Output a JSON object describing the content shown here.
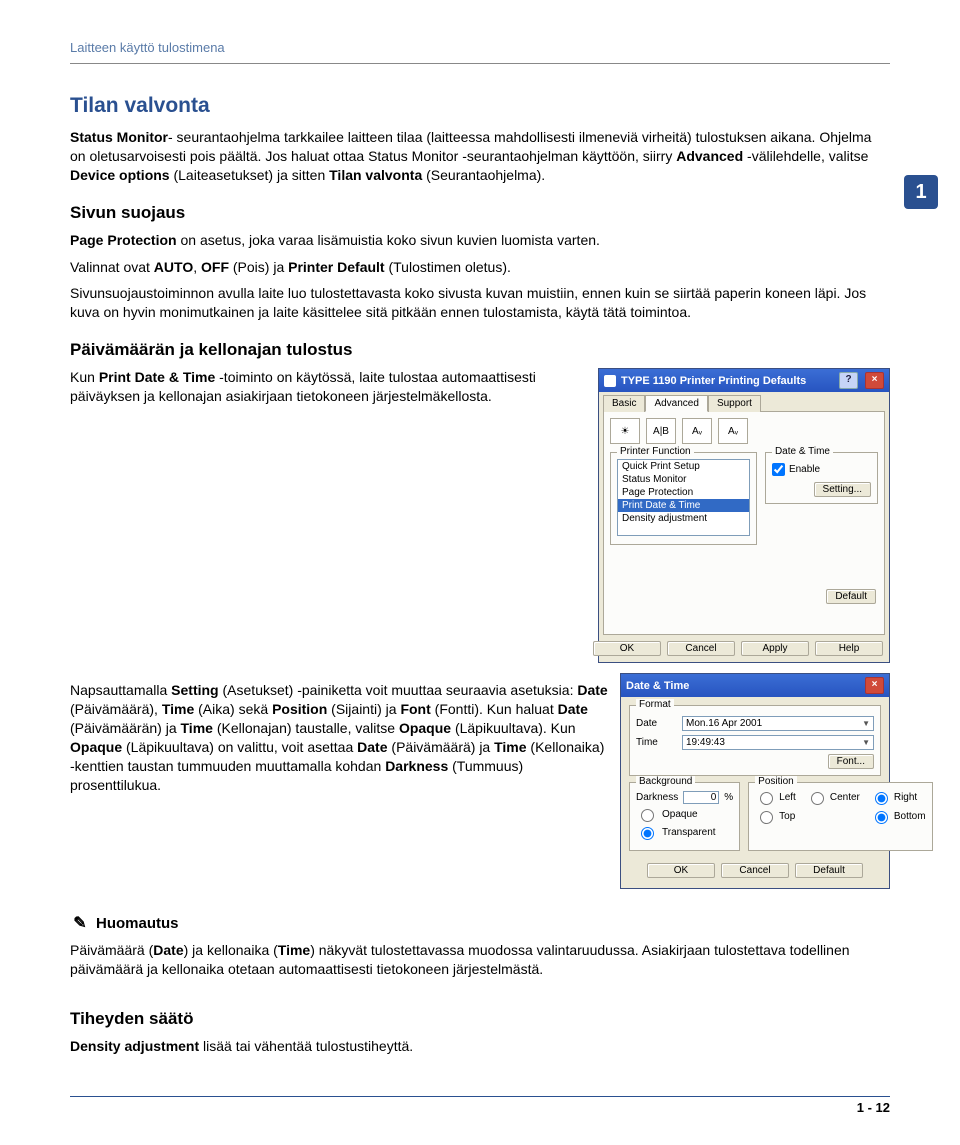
{
  "header": "Laitteen käyttö tulostimena",
  "sectionBadge": "1",
  "tilan": {
    "title": "Tilan valvonta",
    "p1_a": "Status Monitor",
    "p1_b": "- seurantaohjelma tarkkailee laitteen tilaa (laitteessa mahdollisesti ilmeneviä virheitä) tulostuksen aikana. Ohjelma on oletusarvoisesti pois päältä. Jos haluat ottaa Status Monitor -seurantaohjelman käyttöön, siirry ",
    "p1_c": "Advanced",
    "p1_d": " ",
    "p1_e": "-välilehdelle, valitse ",
    "p1_f": "Device options",
    "p1_g": " (Laiteasetukset) ja sitten ",
    "p1_h": "Tilan valvonta",
    "p1_i": " (Seurantaohjelma)."
  },
  "sivun": {
    "title": "Sivun suojaus",
    "p1_a": "Page Protection",
    "p1_b": " on asetus, joka varaa lisämuistia koko sivun kuvien luomista varten.",
    "p2_a": "Valinnat ovat ",
    "p2_b": "AUTO",
    "p2_c": ", ",
    "p2_d": "OFF",
    "p2_e": " (Pois) ja ",
    "p2_f": "Printer Default",
    "p2_g": " (Tulostimen oletus).",
    "p3": "Sivunsuojaustoiminnon avulla laite luo tulostettavasta koko sivusta kuvan muistiin, ennen kuin se siirtää paperin koneen läpi. Jos kuva on hyvin monimutkainen ja laite käsittelee sitä pitkään ennen tulostamista, käytä tätä toimintoa."
  },
  "paiva": {
    "title": "Päivämäärän ja kellonajan tulostus",
    "p1_a": "Kun ",
    "p1_b": "Print Date & Time",
    "p1_c": " -toiminto on käytössä, laite tulostaa automaattisesti päiväyksen ja kellonajan asiakirjaan tietokoneen järjestelmäkellosta.",
    "p2_a": "Napsauttamalla ",
    "p2_b": "Setting",
    "p2_c": " (Asetukset) -painiketta voit muuttaa seuraavia asetuksia: ",
    "p2_d": "Date",
    "p2_e": " (Päivämäärä), ",
    "p2_f": "Time",
    "p2_g": " (Aika) sekä ",
    "p2_h": "Position",
    "p2_i": " (Sijainti) ja ",
    "p2_j": "Font",
    "p2_k": " (Fontti). Kun haluat ",
    "p2_l": "Date",
    "p2_m": " (Päivämäärän) ja ",
    "p2_n": "Time",
    "p2_o": " (Kellonajan) taustalle, valitse ",
    "p2_p": "Opaque",
    "p2_q": " (Läpikuultava). Kun ",
    "p2_r": "Opaque",
    "p2_s": " (Läpikuultava) on valittu, voit asettaa ",
    "p2_t": "Date",
    "p2_u": " (Päivämäärä) ja ",
    "p2_v": "Time",
    "p2_w": " (Kellonaika) -kenttien taustan tummuuden muuttamalla kohdan ",
    "p2_x": "Darkness",
    "p2_y": " (Tummuus) prosenttilukua."
  },
  "note": {
    "title": "Huomautus",
    "p_a": "Päivämäärä (",
    "p_b": "Date",
    "p_c": ") ja kellonaika (",
    "p_d": "Time",
    "p_e": ") näkyvät tulostettavassa muodossa valintaruudussa. Asiakirjaan tulostettava todellinen päivämäärä ja kellonaika otetaan automaattisesti tietokoneen järjestelmästä."
  },
  "tiheys": {
    "title": "Tiheyden säätö",
    "p_a": "Density adjustment",
    "p_b": " lisää tai vähentää tulostustiheyttä."
  },
  "pageNum": "1 - 12",
  "dlg1": {
    "title": "TYPE 1190 Printer Printing Defaults",
    "tabs": {
      "basic": "Basic",
      "advanced": "Advanced",
      "support": "Support"
    },
    "icons": {
      "i1": "☀",
      "i2": "A|B",
      "i3": "Aᵥ",
      "i4": "Aᵥ"
    },
    "pf_label": "Printer Function",
    "list": [
      "Quick Print Setup",
      "Status Monitor",
      "Page Protection",
      "Print Date & Time",
      "Density adjustment"
    ],
    "selectedIndex": 3,
    "dt_label": "Date & Time",
    "enable_label": "Enable",
    "setting_btn": "Setting...",
    "default_btn": "Default",
    "ok": "OK",
    "cancel": "Cancel",
    "apply": "Apply",
    "help": "Help"
  },
  "dlg2": {
    "title": "Date & Time",
    "format_label": "Format",
    "date_label": "Date",
    "time_label": "Time",
    "date_val": "Mon.16 Apr 2001",
    "time_val": "19:49:43",
    "font_btn": "Font...",
    "position_label": "Position",
    "pos": {
      "left": "Left",
      "center": "Center",
      "right": "Right",
      "top": "Top",
      "bottom": "Bottom"
    },
    "bg_label": "Background",
    "darkness_label": "Darkness",
    "darkness_val": "0",
    "pct": "%",
    "opaque": "Opaque",
    "transparent": "Transparent",
    "ok": "OK",
    "cancel": "Cancel",
    "default": "Default"
  }
}
